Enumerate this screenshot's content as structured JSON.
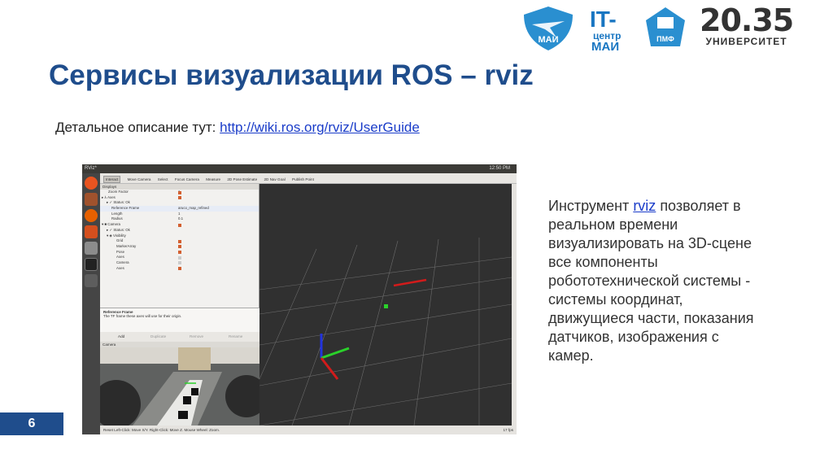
{
  "header": {
    "logo_mai": "МАИ",
    "logo_it_a": "IT-",
    "logo_it_b": "центр",
    "logo_it_c": "МАИ",
    "logo_pmf": "ПМФ",
    "logo_2035_big": "20.35",
    "logo_2035_small": "УНИВЕРСИТЕТ"
  },
  "title": "Сервисы визуализации ROS – rviz",
  "description": {
    "prefix": "Детальное описание тут: ",
    "link": "http://wiki.ros.org/rviz/UserGuide"
  },
  "side_text": {
    "before": "Инструмент ",
    "link": "rviz",
    "after": " позволяет в реальном времени визуализировать на 3D-сцене все компоненты робототехнической системы - системы координат, движущиеся части, показания датчиков, изображения с камер."
  },
  "page_number": "6",
  "rviz": {
    "window_title": "RViz*",
    "clock": "12:50 PM",
    "tools": [
      "Interact",
      "Move Camera",
      "Select",
      "Focus Camera",
      "Measure",
      "2D Pose Estimate",
      "2D Nav Goal",
      "Publish Point"
    ],
    "displays_title": "Displays",
    "rows": [
      {
        "k": "Zoom Factor",
        "v": "1",
        "indent": 10
      },
      {
        "k": "▸ ⅄ Axes",
        "v": "",
        "indent": 2
      },
      {
        "k": "▸ ✓ Status: Ok",
        "v": "",
        "indent": 8
      },
      {
        "k": "Reference Frame",
        "v": "aruco_map_refined",
        "indent": 14
      },
      {
        "k": "Length",
        "v": "1",
        "indent": 14
      },
      {
        "k": "Radius",
        "v": "0.1",
        "indent": 14
      },
      {
        "k": "▾ ■ Camera",
        "v": "",
        "indent": 2
      },
      {
        "k": "▸ ✓ Status: Ok",
        "v": "",
        "indent": 8
      },
      {
        "k": "▾ ◈ Visibility",
        "v": "",
        "indent": 8
      },
      {
        "k": "Grid",
        "v": "",
        "indent": 20
      },
      {
        "k": "MarkerArray",
        "v": "",
        "indent": 20
      },
      {
        "k": "Pose",
        "v": "",
        "indent": 20
      },
      {
        "k": "Axes",
        "v": "",
        "indent": 20
      },
      {
        "k": "Camera",
        "v": "",
        "indent": 20
      },
      {
        "k": "Axes",
        "v": "",
        "indent": 20
      }
    ],
    "help_title": "Reference Frame",
    "help_text": "The TF frame these axes will use for their origin.",
    "buttons": [
      "Add",
      "Duplicate",
      "Remove",
      "Rename"
    ],
    "camera_title": "Camera",
    "status_left": "Reset  Left-Click: Move X/Y. Right-Click: Move Z. Mouse Wheel: Zoom.",
    "status_right": "17 fps"
  }
}
